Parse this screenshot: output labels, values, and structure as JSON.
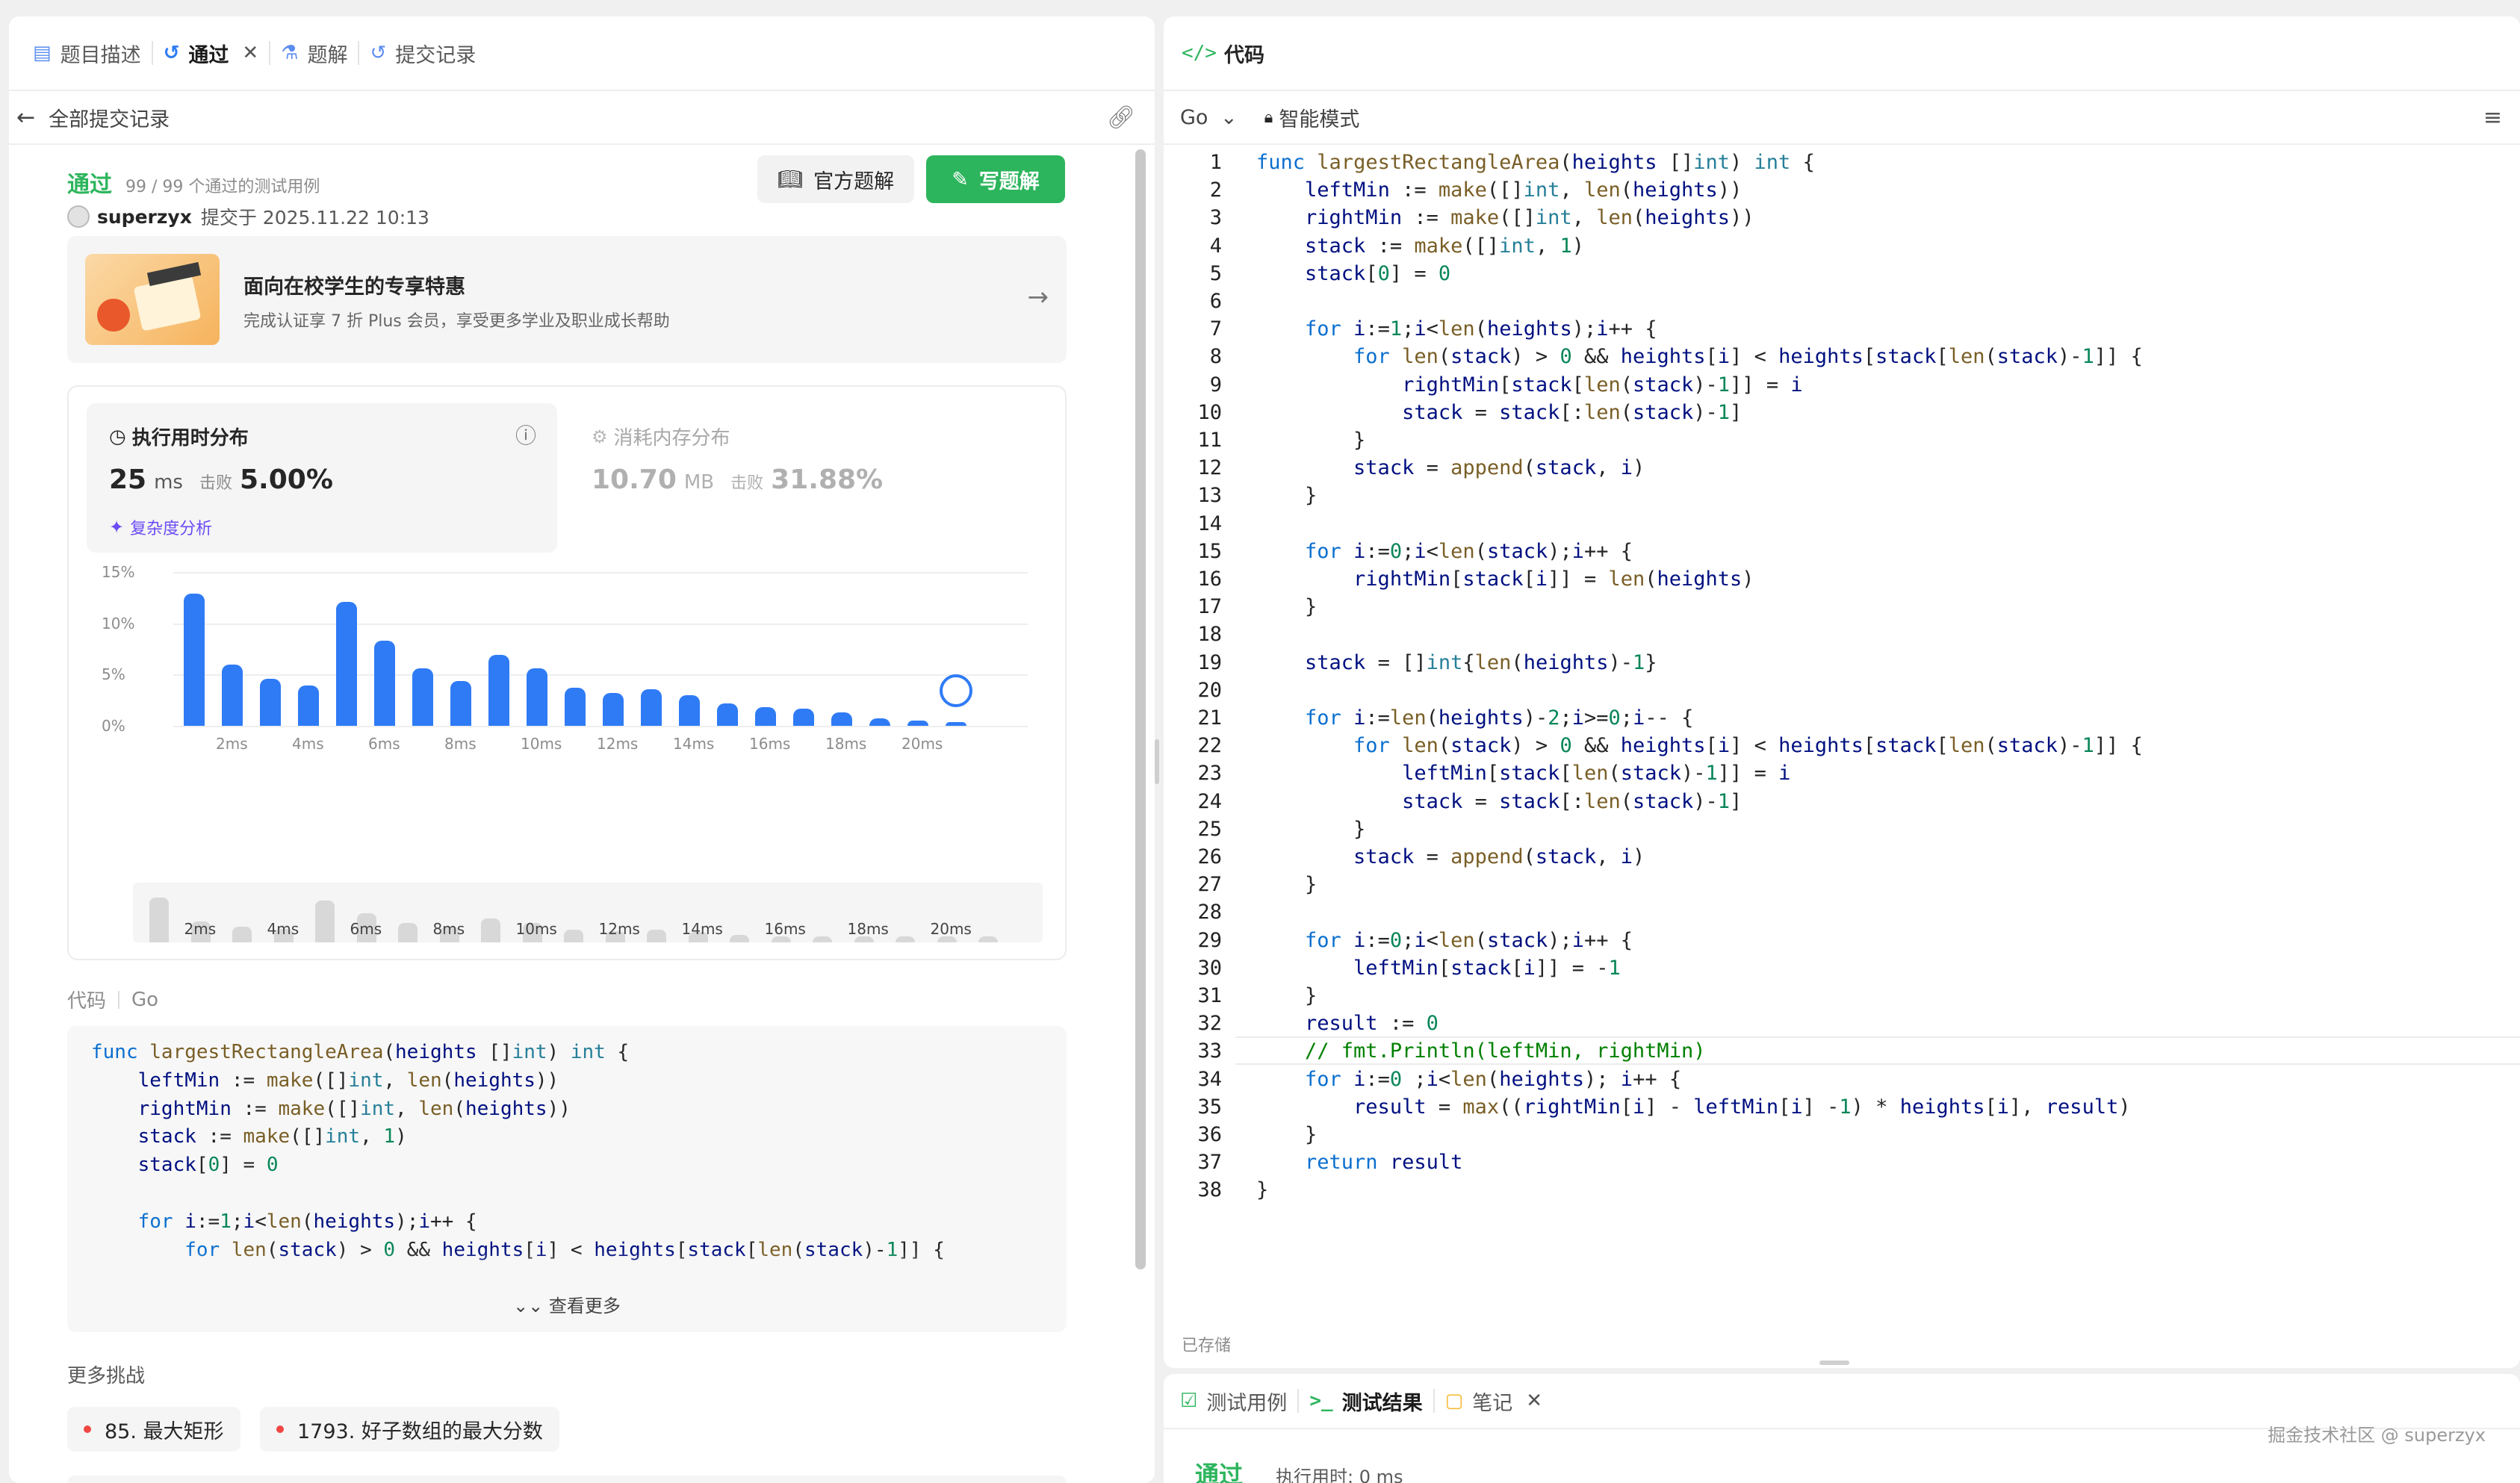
{
  "left_tabs": {
    "desc": "题目描述",
    "passed": "通过",
    "solution": "题解",
    "records": "提交记录"
  },
  "back_label": "全部提交记录",
  "result": {
    "status": "通过",
    "cases": "99 / 99 个通过的测试用例",
    "user": "superzyx",
    "submitted": "提交于 2025.11.22 10:13",
    "official_btn": "官方题解",
    "write_btn": "写题解"
  },
  "promo": {
    "title": "面向在校学生的专享特惠",
    "subtitle": "完成认证享 7 折 Plus 会员，享受更多学业及职业成长帮助"
  },
  "stats": {
    "runtime_title": "执行用时分布",
    "runtime_value": "25",
    "runtime_unit": "ms",
    "beats_label": "击败",
    "runtime_beats": "5.00%",
    "complexity": "复杂度分析",
    "memory_title": "消耗内存分布",
    "memory_value": "10.70",
    "memory_unit": "MB",
    "memory_beats_label": "击败",
    "memory_beats": "31.88%"
  },
  "chart_data": {
    "type": "bar",
    "title": "执行用时分布",
    "y_ticks": [
      "15%",
      "10%",
      "5%",
      "0%"
    ],
    "ylim": [
      0,
      15
    ],
    "x_ticks": [
      "2ms",
      "4ms",
      "6ms",
      "8ms",
      "10ms",
      "12ms",
      "14ms",
      "16ms",
      "18ms",
      "20ms"
    ],
    "values": [
      12.9,
      6.0,
      4.6,
      3.9,
      12.1,
      8.3,
      5.6,
      4.4,
      6.9,
      5.6,
      3.7,
      3.2,
      3.6,
      3.0,
      2.2,
      1.8,
      1.7,
      1.3,
      0.7,
      0.5,
      0.4
    ],
    "current_index": 20,
    "mini_ticks": [
      "2ms",
      "4ms",
      "6ms",
      "8ms",
      "10ms",
      "12ms",
      "14ms",
      "16ms",
      "18ms",
      "20ms"
    ],
    "grid": true
  },
  "code_section": {
    "label": "代码",
    "lang": "Go",
    "lines": [
      "func largestRectangleArea(heights []int) int {",
      "    leftMin := make([]int, len(heights))",
      "    rightMin := make([]int, len(heights))",
      "    stack := make([]int, 1)",
      "    stack[0] = 0",
      "",
      "    for i:=1;i<len(heights);i++ {",
      "        for len(stack) > 0 && heights[i] < heights[stack[len(stack)-1]] {"
    ],
    "more": "查看更多"
  },
  "more_challenges": {
    "label": "更多挑战",
    "items": [
      "85. 最大矩形",
      "1793. 好子数组的最大分数"
    ]
  },
  "editor": {
    "tab_title": "代码",
    "lang": "Go",
    "mode": "智能模式",
    "saved": "已存储",
    "lines": [
      "func largestRectangleArea(heights []int) int {",
      "    leftMin := make([]int, len(heights))",
      "    rightMin := make([]int, len(heights))",
      "    stack := make([]int, 1)",
      "    stack[0] = 0",
      "",
      "    for i:=1;i<len(heights);i++ {",
      "        for len(stack) > 0 && heights[i] < heights[stack[len(stack)-1]] {",
      "            rightMin[stack[len(stack)-1]] = i",
      "            stack = stack[:len(stack)-1]",
      "        }",
      "        stack = append(stack, i)",
      "    }",
      "",
      "    for i:=0;i<len(stack);i++ {",
      "        rightMin[stack[i]] = len(heights)",
      "    }",
      "",
      "    stack = []int{len(heights)-1}",
      "",
      "    for i:=len(heights)-2;i>=0;i-- {",
      "        for len(stack) > 0 && heights[i] < heights[stack[len(stack)-1]] {",
      "            leftMin[stack[len(stack)-1]] = i",
      "            stack = stack[:len(stack)-1]",
      "        }",
      "        stack = append(stack, i)",
      "    }",
      "",
      "    for i:=0;i<len(stack);i++ {",
      "        leftMin[stack[i]] = -1",
      "    }",
      "    result := 0",
      "    // fmt.Println(leftMin, rightMin)",
      "    for i:=0 ;i<len(heights); i++ {",
      "        result = max((rightMin[i] - leftMin[i] -1) * heights[i], result)",
      "    }",
      "    return result",
      "}"
    ]
  },
  "bottom": {
    "tab_cases": "测试用例",
    "tab_result": "测试结果",
    "tab_notes": "笔记",
    "status": "通过",
    "runtime": "执行用时: 0 ms",
    "watermark": "掘金技术社区 @ superzyx"
  },
  "colors": {
    "accent_green": "#2db55d",
    "bar_blue": "#2f7bf5"
  }
}
